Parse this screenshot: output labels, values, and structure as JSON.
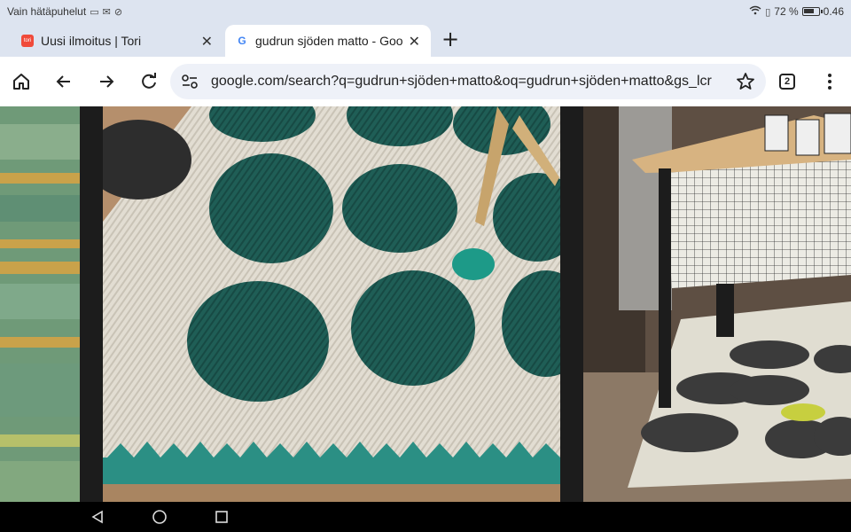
{
  "status_bar": {
    "left_text": "Vain hätäpuhelut",
    "battery_percent_text": "72 %",
    "battery_level": 0.72,
    "time": "0.46"
  },
  "tabs": [
    {
      "title": "Uusi ilmoitus | Tori",
      "favicon": "tori-icon",
      "active": false
    },
    {
      "title": "gudrun sjöden matto - Goog",
      "favicon": "google-icon",
      "active": true
    }
  ],
  "favicon_text": {
    "tori": "tori",
    "google": "G"
  },
  "toolbar": {
    "url": "google.com/search?q=gudrun+sjöden+matto&oq=gudrun+sjöden+matto&gs_lcr",
    "tab_count": "2"
  },
  "colors": {
    "chrome_bg": "#dde4f0",
    "omnibox_bg": "#eef1f8",
    "rug_cream": "#e2ddd2",
    "rug_teal": "#1f5e56",
    "rug_charcoal": "#3b3b3b",
    "accent_lime": "#c7cf3f"
  }
}
